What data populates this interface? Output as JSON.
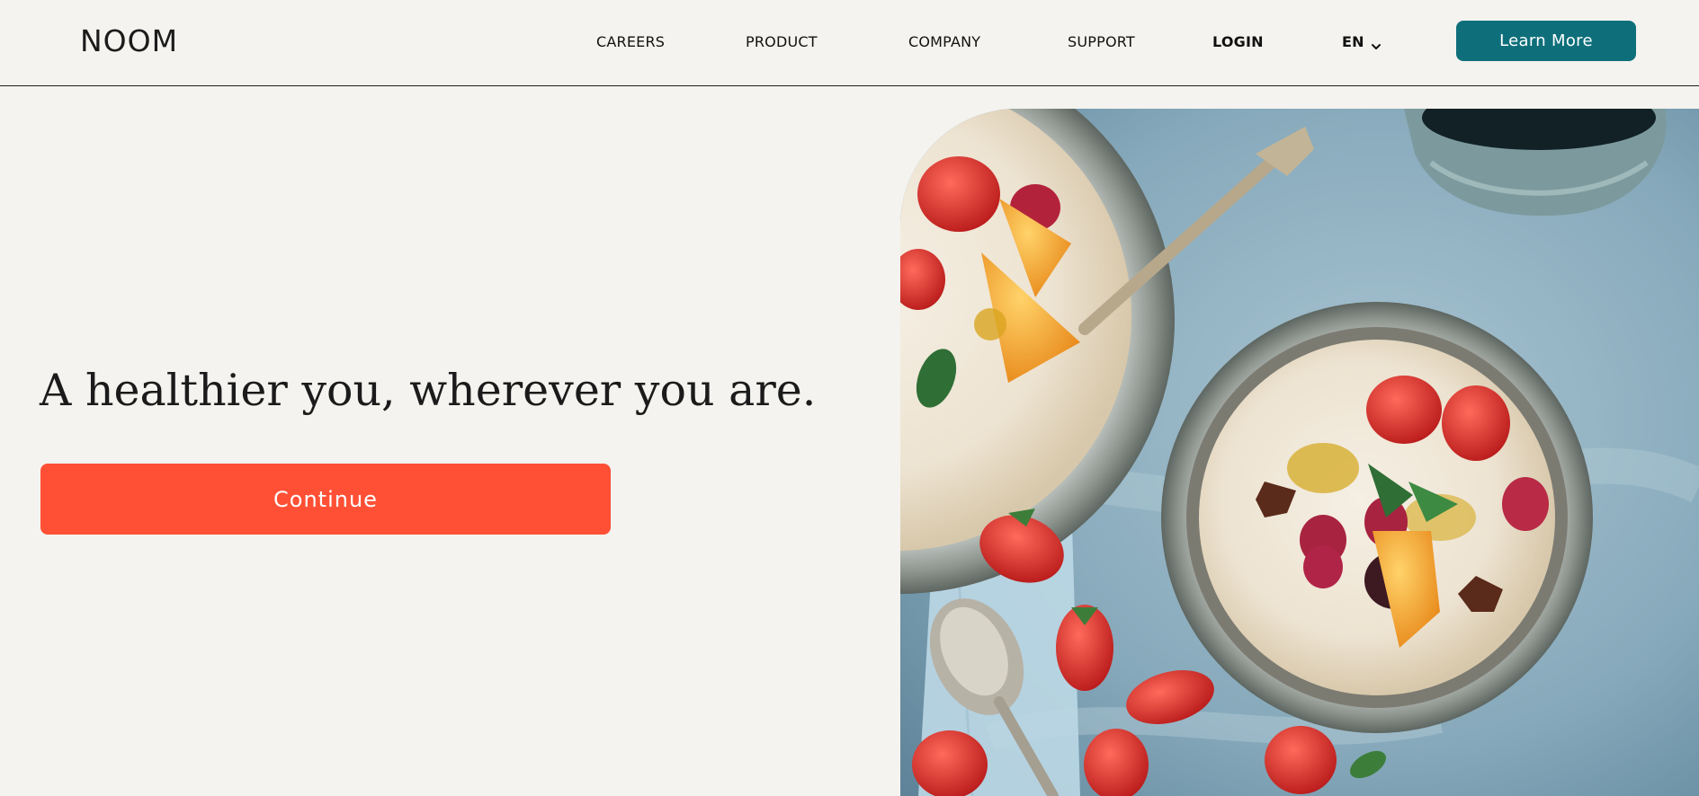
{
  "header": {
    "logo": "NOOM",
    "nav": {
      "careers": "CAREERS",
      "product": "PRODUCT",
      "company": "COMPANY",
      "support": "SUPPORT",
      "login": "LOGIN",
      "language": "EN"
    },
    "learn_more_label": "Learn More"
  },
  "main": {
    "headline": "A healthier you, wherever you are.",
    "continue_label": "Continue"
  },
  "colors": {
    "background": "#f4f3ef",
    "teal_button": "#0e6f7b",
    "coral_button": "#ff5035"
  },
  "icons": {
    "language_dropdown": "chevron-down-icon"
  }
}
